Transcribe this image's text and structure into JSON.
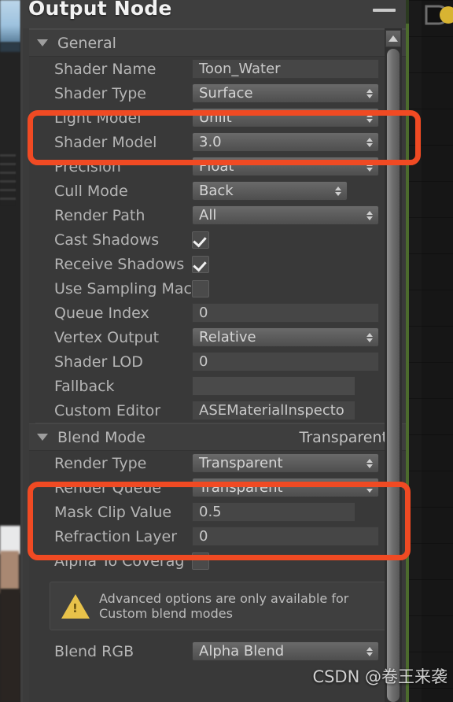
{
  "window": {
    "title": "Output Node",
    "minimize_label": "—"
  },
  "sections": {
    "general": {
      "label": "General",
      "rows": [
        {
          "label": "Shader Name",
          "type": "text",
          "value": "Toon_Water"
        },
        {
          "label": "Shader Type",
          "type": "popup",
          "value": "Surface"
        },
        {
          "label": "Light Model",
          "type": "popup",
          "value": "Unlit"
        },
        {
          "label": "Shader Model",
          "type": "popup",
          "value": "3.0"
        },
        {
          "label": "Precision",
          "type": "popup",
          "value": "Float"
        },
        {
          "label": "Cull Mode",
          "type": "popup-short",
          "value": "Back",
          "dot": true
        },
        {
          "label": "Render Path",
          "type": "popup",
          "value": "All"
        },
        {
          "label": "Cast Shadows",
          "type": "checkbox",
          "value": "checked"
        },
        {
          "label": "Receive Shadows",
          "type": "checkbox",
          "value": "checked"
        },
        {
          "label": "Use Sampling Mac",
          "type": "checkbox",
          "value": "unchecked"
        },
        {
          "label": "Queue Index",
          "type": "text",
          "value": "0"
        },
        {
          "label": "Vertex Output",
          "type": "popup",
          "value": "Relative"
        },
        {
          "label": "Shader LOD",
          "type": "text",
          "value": "0"
        },
        {
          "label": "Fallback",
          "type": "text-updown",
          "value": ""
        },
        {
          "label": "Custom Editor",
          "type": "text-refresh",
          "value": "ASEMaterialInspecto"
        }
      ]
    },
    "blend_mode": {
      "label": "Blend Mode",
      "value": "Transparent",
      "rows": [
        {
          "label": "Render Type",
          "type": "popup",
          "value": "Transparent"
        },
        {
          "label": "Render Queue",
          "type": "popup",
          "value": "Transparent"
        },
        {
          "label": "Mask Clip Value",
          "type": "text",
          "value": "0.5",
          "dot": true
        },
        {
          "label": "Refraction Layer",
          "type": "text",
          "value": "0"
        },
        {
          "label": "Alpha To Coverag",
          "type": "checkbox",
          "value": "unchecked",
          "dot": true
        }
      ],
      "helpbox": {
        "icon": "warning-triangle-icon",
        "line1": "Advanced options are only available for",
        "line2": "Custom blend modes"
      },
      "rows_after": [
        {
          "label": "Blend RGB",
          "type": "popup",
          "value": "Alpha Blend"
        }
      ]
    }
  },
  "annotations": {
    "highlight_1": "light-model-shader-model-highlight",
    "highlight_2": "render-type-render-queue-highlight",
    "color": "#f04a23"
  },
  "watermark": {
    "text": "CSDN @卷王来袭"
  },
  "scrollbar": {
    "up_arrow": "scroll-up-arrow-icon"
  }
}
